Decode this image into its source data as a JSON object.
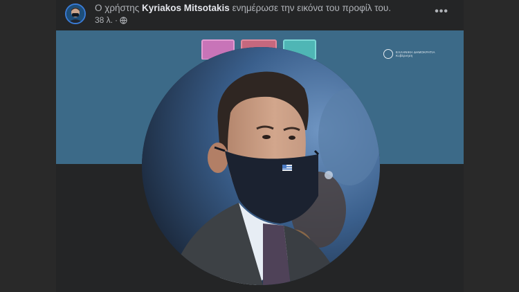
{
  "post": {
    "prefix": "Ο χρήστης",
    "author": "Kyriakos Mitsotakis",
    "action": "ενημέρωσε την εικόνα του προφίλ του.",
    "time": "38 λ.",
    "separator": "·",
    "privacy_icon": "globe-icon",
    "more_icon": "more-options-icon",
    "more_label": "•••"
  },
  "cover": {
    "logo_line1": "ΕΛΛΗΝΙΚΗ ΔΗΜΟΚΡΑΤΙΑ",
    "logo_line2": "Κυβέρνηση"
  },
  "colors": {
    "cover_background": "#3c6a88",
    "card_background": "#242526",
    "accent_ring": "#3a7bd5",
    "mask": "#1b2230"
  }
}
